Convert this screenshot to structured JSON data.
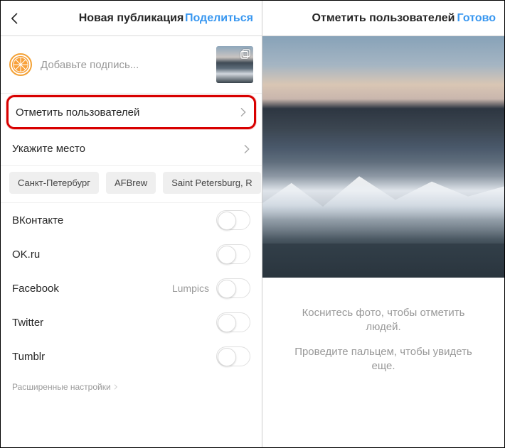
{
  "left": {
    "header": {
      "title": "Новая публикация",
      "action": "Поделиться"
    },
    "caption_placeholder": "Добавьте подпись...",
    "tag_users": "Отметить пользователей",
    "add_location": "Укажите место",
    "location_chips": [
      "Санкт-Петербург",
      "AFBrew",
      "Saint Petersburg, R"
    ],
    "share": [
      {
        "name": "ВКонтакте",
        "sub": ""
      },
      {
        "name": "OK.ru",
        "sub": ""
      },
      {
        "name": "Facebook",
        "sub": "Lumpics"
      },
      {
        "name": "Twitter",
        "sub": ""
      },
      {
        "name": "Tumblr",
        "sub": ""
      }
    ],
    "advanced": "Расширенные настройки"
  },
  "right": {
    "header": {
      "title": "Отметить пользователей",
      "action": "Готово"
    },
    "hint1": "Коснитесь фото, чтобы отметить людей.",
    "hint2": "Проведите пальцем, чтобы увидеть еще."
  }
}
